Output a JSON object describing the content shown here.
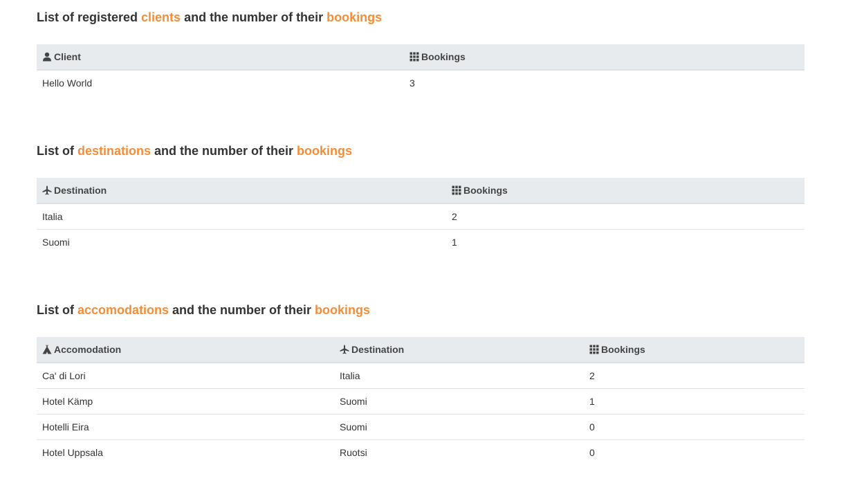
{
  "colors": {
    "accent": "#f48d38",
    "header_bg": "#e8ebee",
    "text": "#333333"
  },
  "clients": {
    "title": {
      "prefix": "List of registered ",
      "highlight1": "clients",
      "middle": " and the number of their ",
      "highlight2": "bookings"
    },
    "columns": [
      {
        "label": "Client",
        "icon": "user-icon"
      },
      {
        "label": "Bookings",
        "icon": "grid-icon"
      }
    ],
    "rows": [
      {
        "client": "Hello World",
        "bookings": "3"
      }
    ]
  },
  "destinations": {
    "title": {
      "prefix": "List of ",
      "highlight1": "destinations",
      "middle": " and the number of their ",
      "highlight2": "bookings"
    },
    "columns": [
      {
        "label": "Destination",
        "icon": "plane-icon"
      },
      {
        "label": "Bookings",
        "icon": "grid-icon"
      }
    ],
    "rows": [
      {
        "destination": "Italia",
        "bookings": "2"
      },
      {
        "destination": "Suomi",
        "bookings": "1"
      }
    ]
  },
  "accomodations": {
    "title": {
      "prefix": "List of ",
      "highlight1": "accomodations",
      "middle": " and the number of their ",
      "highlight2": "bookings"
    },
    "columns": [
      {
        "label": "Accomodation",
        "icon": "tent-icon"
      },
      {
        "label": "Destination",
        "icon": "plane-icon"
      },
      {
        "label": "Bookings",
        "icon": "grid-icon"
      }
    ],
    "rows": [
      {
        "accomodation": "Ca' di Lori",
        "destination": "Italia",
        "bookings": "2"
      },
      {
        "accomodation": "Hotel Kämp",
        "destination": "Suomi",
        "bookings": "1"
      },
      {
        "accomodation": "Hotelli Eira",
        "destination": "Suomi",
        "bookings": "0"
      },
      {
        "accomodation": "Hotel Uppsala",
        "destination": "Ruotsi",
        "bookings": "0"
      }
    ]
  }
}
